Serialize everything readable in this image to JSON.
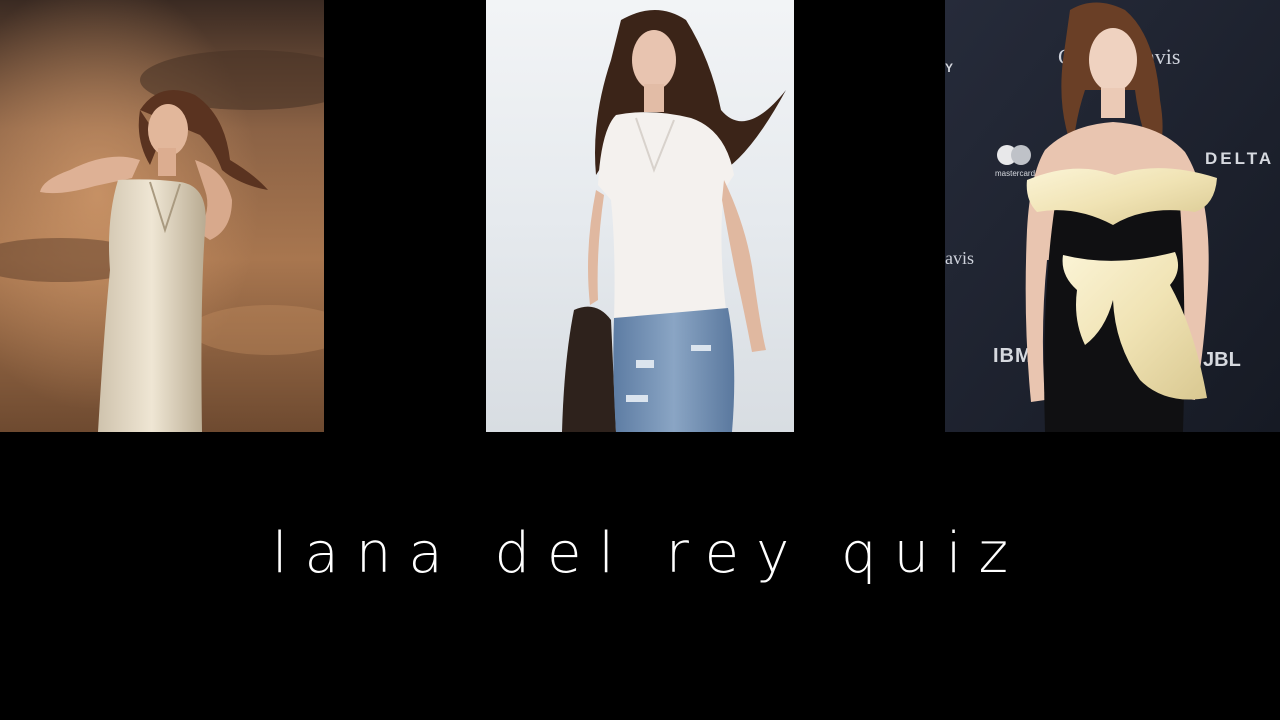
{
  "title": "lana del rey quiz",
  "photos": [
    {
      "icon": "portrait-sunset-sky-photo",
      "background": "#7a5638"
    },
    {
      "icon": "portrait-beach-walk-photo",
      "background": "#e9edf0"
    },
    {
      "icon": "portrait-red-carpet-photo",
      "background": "#1d2230"
    }
  ],
  "backdrop_logos": [
    "avis",
    "mastercard",
    "DELTA",
    "avis",
    "IBM",
    "JBL"
  ],
  "colors": {
    "background": "#000000",
    "text": "#ffffff"
  }
}
